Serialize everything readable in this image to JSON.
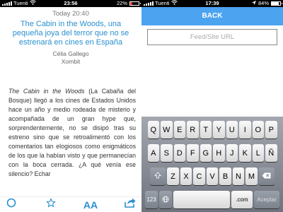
{
  "left_status": {
    "carrier": "Tuenti",
    "time": "23:56",
    "battery": "22%"
  },
  "right_status": {
    "carrier": "Tuenti",
    "time": "17:39",
    "battery": "84%"
  },
  "article": {
    "date": "Today 20:40",
    "title": "The Cabin in the Woods, una pequeña joya del terror que no se estrenará en cines en España",
    "author": "Célia Gallego",
    "source": "Xombit",
    "body_em": "The Cabin in the Woods",
    "body_rest": " (La Cabaña del Bosque) llegó a los cines de Estados Unidos hace un año y medio rodeada de misterio y acompañada de un gran hype que, sorprendentemente, no se disipó tras su estreno sino que se retroalimentó con los comentarios tan elogiosos como enigmáticos de los que la habían visto y que permanecían con la boca cerrada. ¿A qué venía ese silencio? Echar"
  },
  "toolbar": {
    "font_label": "AA"
  },
  "feed": {
    "back_label": "BACK",
    "url_placeholder": "Feed/Site URL"
  },
  "keyboard": {
    "row1": [
      "Q",
      "W",
      "E",
      "R",
      "T",
      "Y",
      "U",
      "I",
      "O",
      "P"
    ],
    "row2": [
      "A",
      "S",
      "D",
      "F",
      "G",
      "H",
      "J",
      "K",
      "L",
      "Ñ"
    ],
    "row3": [
      "Z",
      "X",
      "C",
      "V",
      "B",
      "N",
      "M"
    ],
    "num_label": "123",
    "com_label": ".com",
    "return_label": "Aceptar"
  },
  "colors": {
    "accent": "#2a8fd0",
    "back_bar": "#4ca3f0"
  },
  "icons": [
    "wifi-icon",
    "compass-icon",
    "star-icon",
    "font-size-icon",
    "share-icon",
    "shift-icon",
    "delete-icon",
    "globe-icon"
  ]
}
